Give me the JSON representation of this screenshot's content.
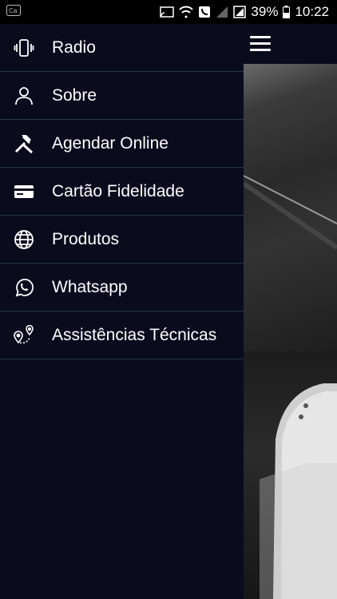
{
  "status_bar": {
    "battery": "39%",
    "time": "10:22",
    "icons": [
      "app-notification-icon",
      "cast-icon",
      "wifi-icon",
      "call-icon",
      "signal-icon",
      "data-signal-icon",
      "battery-icon"
    ]
  },
  "drawer": {
    "items": [
      {
        "label": "Radio",
        "icon": "radio-phone-icon"
      },
      {
        "label": "Sobre",
        "icon": "person-icon"
      },
      {
        "label": "Agendar Online",
        "icon": "tools-icon"
      },
      {
        "label": "Cartão Fidelidade",
        "icon": "card-icon"
      },
      {
        "label": "Produtos",
        "icon": "globe-icon"
      },
      {
        "label": "Whatsapp",
        "icon": "whatsapp-icon"
      },
      {
        "label": "Assistências Técnicas",
        "icon": "route-icon"
      }
    ]
  },
  "topbar": {
    "menu_icon": "hamburger-icon"
  },
  "colors": {
    "background": "#0b0b1e",
    "divider": "#1f3c48",
    "text": "#ffffff"
  }
}
